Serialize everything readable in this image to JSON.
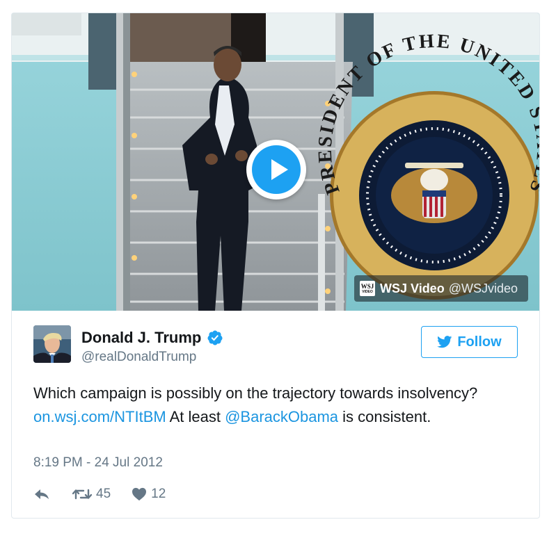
{
  "media": {
    "play_icon": "play-icon",
    "source_logo_lines": [
      "WSJ",
      "VIDEO"
    ],
    "source_name": "WSJ Video",
    "source_handle": "@WSJvideo",
    "seal_text": "PRESIDENT OF THE UNITED STATES · SEAL OF ·"
  },
  "author": {
    "display_name": "Donald J. Trump",
    "handle": "@realDonaldTrump",
    "verified_icon": "verified-badge-icon"
  },
  "follow_button": {
    "label": "Follow",
    "icon": "twitter-bird-icon"
  },
  "tweet": {
    "text_part1": "Which campaign is possibly on the trajectory towards insolvency? ",
    "link": "on.wsj.com/NTItBM",
    "text_part2": " At least ",
    "mention": "@BarackObama",
    "text_part3": " is consistent."
  },
  "timestamp": "8:19 PM - 24 Jul 2012",
  "actions": {
    "reply_icon": "reply-icon",
    "retweet_icon": "retweet-icon",
    "retweet_count": "45",
    "like_icon": "heart-icon",
    "like_count": "12"
  },
  "colors": {
    "accent": "#1da1f2",
    "link": "#1b95e0",
    "secondary_text": "#657786",
    "border": "#e1e8ed"
  }
}
